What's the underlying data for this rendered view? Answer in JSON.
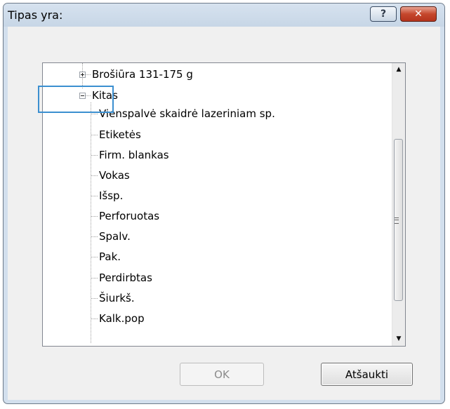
{
  "window": {
    "title": "Tipas yra:"
  },
  "titlebar_buttons": {
    "help": "?",
    "close": "✕"
  },
  "tree": {
    "collapsed_parent": "Brošiūra 131-175 g",
    "expanded_parent": "Kitas",
    "children": [
      "Vienspalvė skaidrė lazeriniam sp.",
      "Etiketės",
      "Firm. blankas",
      "Vokas",
      "Išsp.",
      "Perforuotas",
      "Spalv.",
      "Pak.",
      "Perdirbtas",
      "Šiurkš.",
      "Kalk.pop"
    ]
  },
  "buttons": {
    "ok": "OK",
    "cancel": "Atšaukti"
  },
  "icons": {
    "scroll_up": "up-arrow",
    "scroll_down": "down-arrow",
    "expand": "plus-box",
    "collapse": "minus-box"
  }
}
